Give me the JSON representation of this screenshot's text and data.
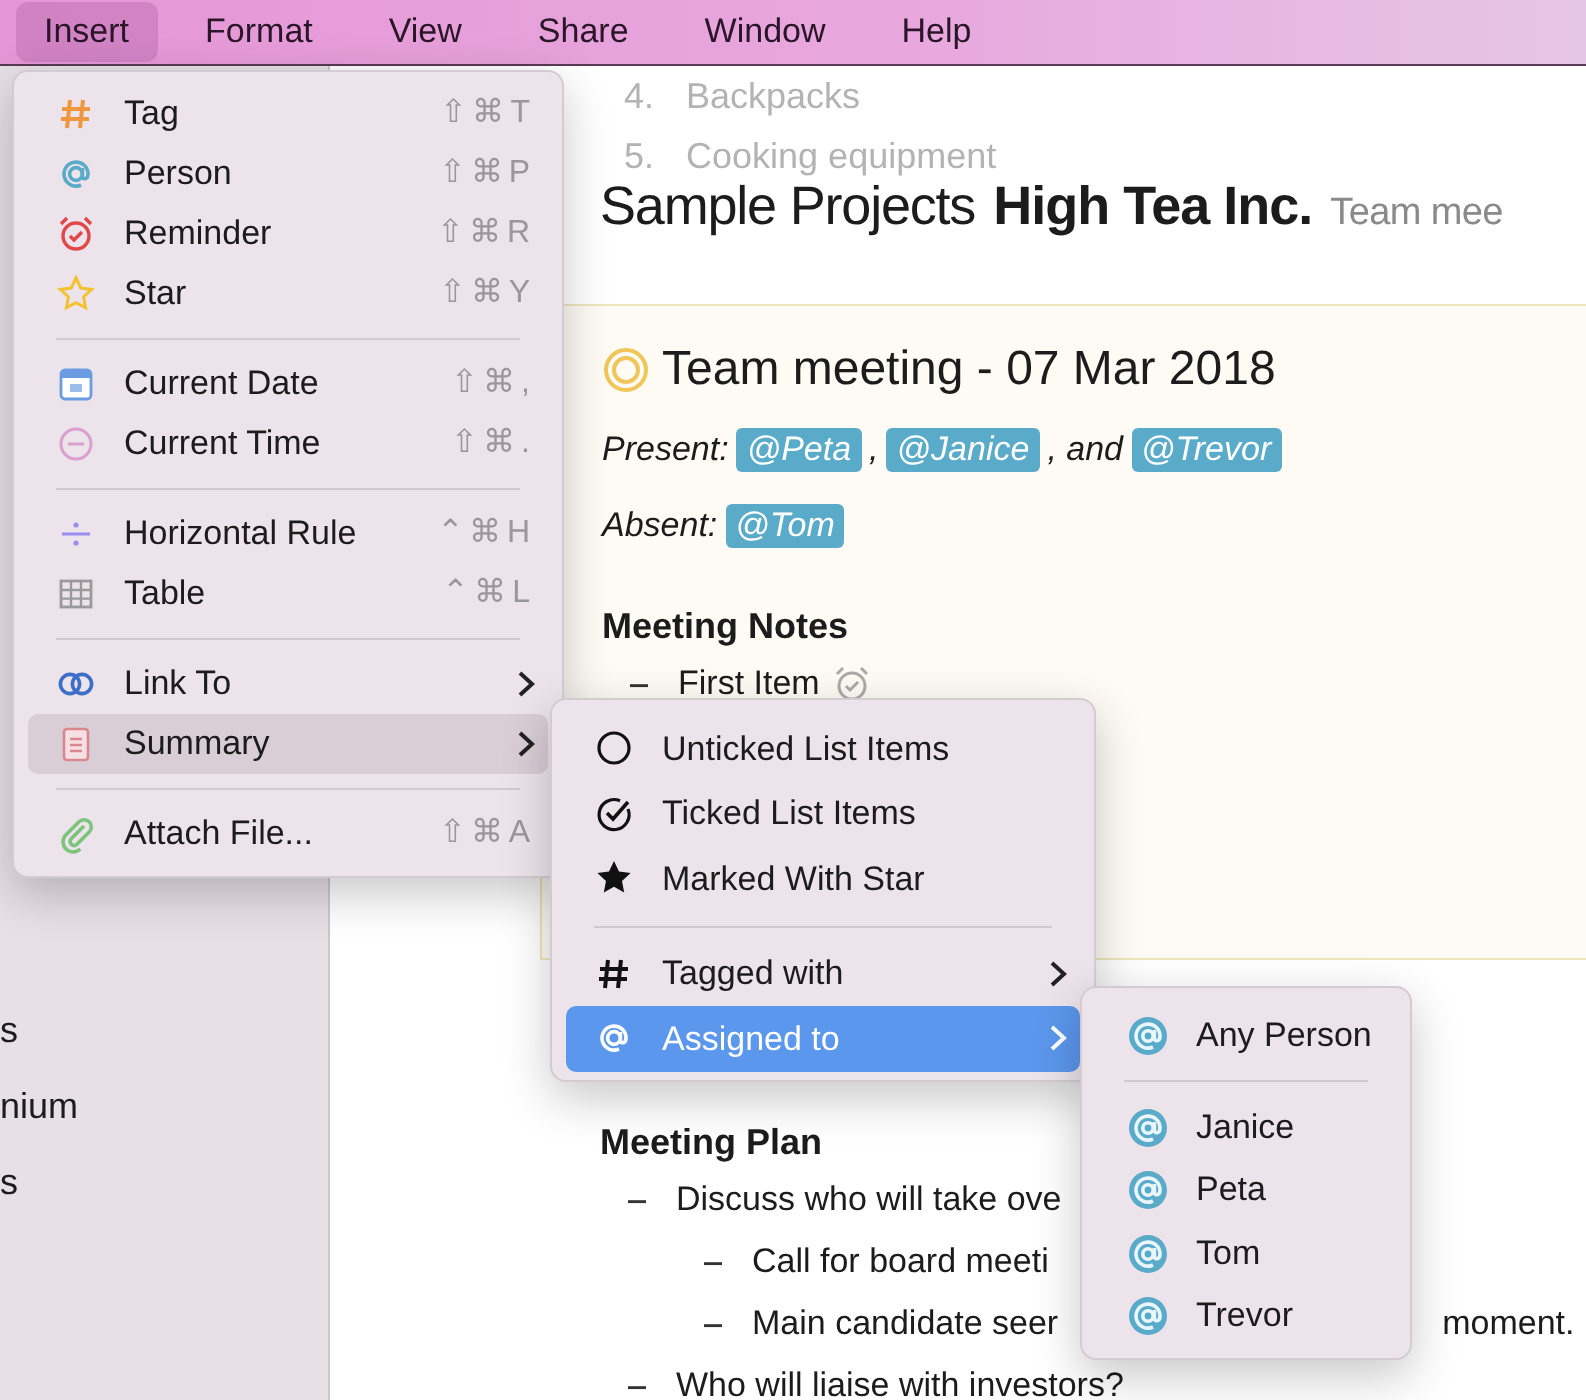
{
  "menubar": [
    {
      "label": "Insert",
      "selected": true
    },
    {
      "label": "Format",
      "selected": false
    },
    {
      "label": "View",
      "selected": false
    },
    {
      "label": "Share",
      "selected": false
    },
    {
      "label": "Window",
      "selected": false
    },
    {
      "label": "Help",
      "selected": false
    }
  ],
  "sidebar": {
    "items": [
      "s",
      "nium",
      "s"
    ]
  },
  "editor": {
    "faded_list": [
      {
        "number": "4.",
        "text": "Backpacks"
      },
      {
        "number": "5.",
        "text": "Cooking equipment"
      }
    ],
    "breadcrumb": {
      "notebook": "Sample Projects",
      "note": "High Tea Inc.",
      "section": "Team mee"
    },
    "meeting": {
      "title": "Team meeting - 07 Mar 2018",
      "lines": [
        [
          {
            "kind": "text",
            "text": "Present:"
          },
          {
            "kind": "mention",
            "text": "@Peta"
          },
          {
            "kind": "text",
            "text": ","
          },
          {
            "kind": "mention",
            "text": "@Janice"
          },
          {
            "kind": "text",
            "text": ", and"
          },
          {
            "kind": "mention",
            "text": "@Trevor"
          }
        ],
        [
          {
            "kind": "text",
            "text": "Absent:"
          },
          {
            "kind": "mention",
            "text": "@Tom"
          }
        ]
      ],
      "notes_heading": "Meeting Notes",
      "notes": [
        {
          "text": "First Item",
          "reminder": true
        }
      ]
    },
    "plan_heading": "Meeting Plan",
    "plan": [
      {
        "text": "Discuss who will take ove",
        "children": [
          {
            "text": "Call for board meeti"
          },
          {
            "text": "Main candidate seer",
            "tail": "moment."
          }
        ]
      },
      {
        "text": "Who will liaise with investors?"
      }
    ]
  },
  "insert_menu": {
    "groups": [
      [
        {
          "label": "Tag",
          "shortcut": "⇧⌘T",
          "submenu": false,
          "selected": false
        },
        {
          "label": "Person",
          "shortcut": "⇧⌘P",
          "submenu": false,
          "selected": false
        },
        {
          "label": "Reminder",
          "shortcut": "⇧⌘R",
          "submenu": false,
          "selected": false
        },
        {
          "label": "Star",
          "shortcut": "⇧⌘Y",
          "submenu": false,
          "selected": false
        }
      ],
      [
        {
          "label": "Current Date",
          "shortcut": "⇧⌘,",
          "submenu": false,
          "selected": false
        },
        {
          "label": "Current Time",
          "shortcut": "⇧⌘.",
          "submenu": false,
          "selected": false
        }
      ],
      [
        {
          "label": "Horizontal Rule",
          "shortcut": "⌃⌘H",
          "submenu": false,
          "selected": false
        },
        {
          "label": "Table",
          "shortcut": "⌃⌘L",
          "submenu": false,
          "selected": false
        }
      ],
      [
        {
          "label": "Link To",
          "submenu": true,
          "selected": false
        },
        {
          "label": "Summary",
          "submenu": true,
          "selected": true
        }
      ],
      [
        {
          "label": "Attach File...",
          "shortcut": "⇧⌘A",
          "submenu": false,
          "selected": false
        }
      ]
    ]
  },
  "summary_menu": {
    "groups": [
      [
        {
          "label": "Unticked List Items",
          "submenu": false,
          "selected": false
        },
        {
          "label": "Ticked List Items",
          "submenu": false,
          "selected": false
        },
        {
          "label": "Marked With Star",
          "submenu": false,
          "selected": false
        }
      ],
      [
        {
          "label": "Tagged with",
          "submenu": true,
          "selected": false
        },
        {
          "label": "Assigned to",
          "submenu": true,
          "selected": true
        }
      ]
    ]
  },
  "assigned_menu": {
    "groups": [
      [
        {
          "label": "Any Person",
          "selected": false
        }
      ],
      [
        {
          "label": "Janice",
          "selected": false
        },
        {
          "label": "Peta",
          "selected": false
        },
        {
          "label": "Tom",
          "selected": false
        },
        {
          "label": "Trevor",
          "selected": false
        }
      ]
    ]
  }
}
